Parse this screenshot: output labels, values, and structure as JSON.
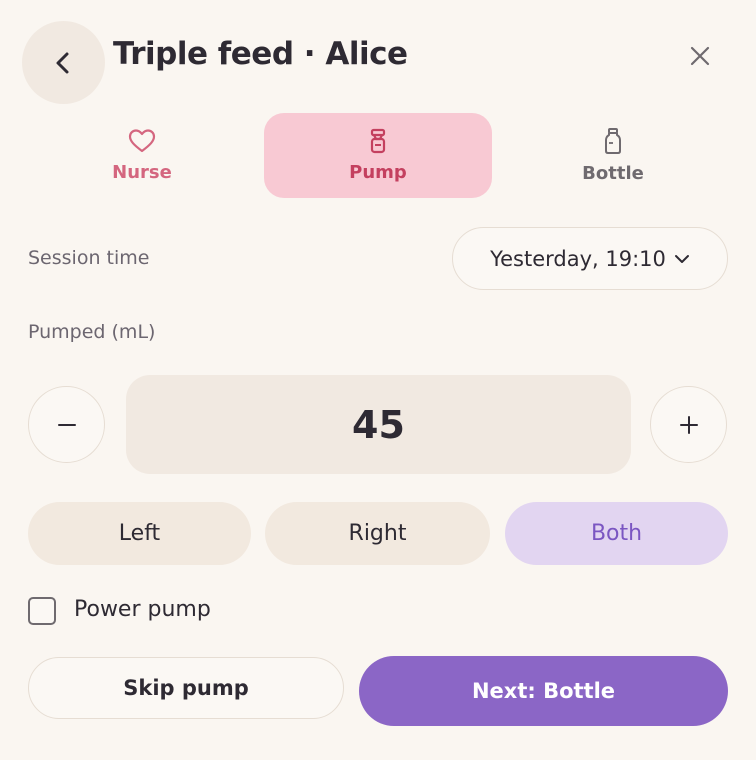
{
  "header": {
    "back_icon": "chevron-left-icon",
    "title": "Triple feed · Alice",
    "close_icon": "close-icon"
  },
  "tabs": [
    {
      "label": "Nurse",
      "icon": "heart-icon",
      "color": "#d4667f",
      "selected": false
    },
    {
      "label": "Pump",
      "icon": "pump-icon",
      "color": "#c4405f",
      "selected": true
    },
    {
      "label": "Bottle",
      "icon": "bottle-icon",
      "color": "#6f6a6f",
      "selected": false
    }
  ],
  "session": {
    "label": "Session time",
    "value": "Yesterday, 19:10",
    "dropdown_icon": "chevron-down-icon"
  },
  "pumped": {
    "label": "Pumped (mL)",
    "value": "45",
    "minus_icon": "minus-icon",
    "plus_icon": "plus-icon"
  },
  "sides": {
    "options": [
      "Left",
      "Right",
      "Both"
    ],
    "selected": "Both"
  },
  "power_pump": {
    "label": "Power pump",
    "checked": false
  },
  "actions": {
    "skip_label": "Skip pump",
    "next_label": "Next: Bottle"
  },
  "colors": {
    "background": "#faf6f1",
    "accent": "#8b66c6",
    "pump_tab_bg": "#f8c9d3",
    "selected_side_bg": "#e2d5f1"
  }
}
